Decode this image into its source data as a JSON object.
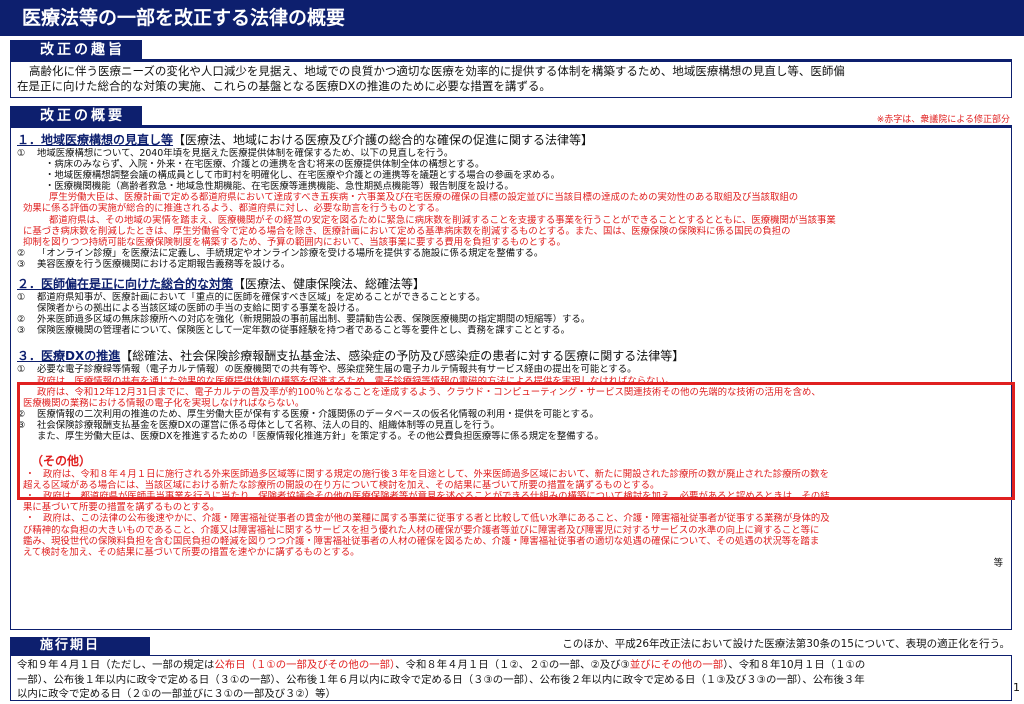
{
  "title": "医療法等の一部を改正する法律の概要",
  "shushi": {
    "label": "改正の趣旨",
    "lines": [
      "高齢化に伴う医療ニーズの変化や人口減少を見据え、地域での良質かつ適切な医療を効率的に提供する体制を構築するため、地域医療構想の見直し等、医師偏",
      "在是正に向けた総合的な対策の実施、これらの基盤となる医療DXの推進のために必要な措置を講ずる。"
    ]
  },
  "gaiyo": {
    "label": "改正の概要",
    "note": "※赤字は、衆議院による修正部分",
    "s1": {
      "num": "１．",
      "heading": "地域医療構想の見直し等",
      "law": "【医療法、地域における医療及び介護の総合的な確保の促進に関する法律等】",
      "i1": {
        "num": "①",
        "text": "地域医療構想について、2040年頃を見据えた医療提供体制を確保するため、以下の見直しを行う。",
        "subs": [
          "・病床のみならず、入院・外来・在宅医療、介護との連携を含む将来の医療提供体制全体の構想とする。",
          "・地域医療構想調整会議の構成員として市町村を明確化し、在宅医療や介護との連携等を議題とする場合の参画を求める。",
          "・医療機関機能（高齢者救急・地域急性期機能、在宅医療等連携機能、急性期拠点機能等）報告制度を設ける。"
        ],
        "red": [
          "厚生労働大臣は、医療計画で定める都道府県において達成すべき五疾病・六事業及び在宅医療の確保の目標の設定並びに当該目標の達成のための実効性のある取組及び当該取組の",
          "効果に係る評価の実施が総合的に推進されるよう、都道府県に対し、必要な助言を行うものとする。",
          "都道府県は、その地域の実情を踏まえ、医療機関がその経営の安定を図るために緊急に病床数を削減することを支援する事業を行うことができることとするとともに、医療機関が当該事業",
          "に基づき病床数を削減したときは、厚生労働省令で定める場合を除き、医療計画において定める基準病床数を削減するものとする。また、国は、医療保険の保険料に係る国民の負担の",
          "抑制を図りつつ持続可能な医療保険制度を構築するため、予算の範囲内において、当該事業に要する費用を負担するものとする。"
        ]
      },
      "i2": {
        "num": "②",
        "text": "「オンライン診療」を医療法に定義し、手続規定やオンライン診療を受ける場所を提供する施設に係る規定を整備する。"
      },
      "i3": {
        "num": "③",
        "text": "美容医療を行う医療機関における定期報告義務等を設ける。"
      }
    },
    "s2": {
      "num": "２．",
      "heading": "医師偏在是正に向けた総合的な対策",
      "law": "【医療法、健康保険法、総確法等】",
      "i1": {
        "num": "①",
        "text": "都道府県知事が、医療計画において「重点的に医師を確保すべき区域」を定めることができることとする。",
        "cont": "保険者からの拠出による当該区域の医師の手当の支給に関する事業を設ける。"
      },
      "i2": {
        "num": "②",
        "text": "外来医師過多区域の無床診療所への対応を強化（新規開設の事前届出制、要請勧告公表、保険医療機関の指定期間の短縮等）する。"
      },
      "i3": {
        "num": "③",
        "text": "保険医療機関の管理者について、保険医として一定年数の従事経験を持つ者であること等を要件とし、責務を課すこととする。"
      }
    },
    "s3": {
      "num": "３．",
      "heading": "医療DXの推進",
      "law": "【総確法、社会保険診療報酬支払基金法、感染症の予防及び感染症の患者に対する医療に関する法律等】",
      "i1": {
        "num": "①",
        "text": "必要な電子診療録等情報（電子カルテ情報）の医療機関での共有等や、感染症発生届の電子カルテ情報共有サービス経由の提出を可能とする。",
        "red": [
          "政府は、医療情報の共有を通じた効果的な医療提供体制の構築を促進するため、電子診療録等情報の電磁的方法による提供を実現しなければならない。",
          "政府は、令和12年12月31日までに、電子カルテの普及率が約100％となることを達成するよう、クラウド・コンピューティング・サービス関連技術その他の先端的な技術の活用を含め、",
          "医療機関の業務における情報の電子化を実現しなければならない。"
        ]
      },
      "i2": {
        "num": "②",
        "text": "医療情報の二次利用の推進のため、厚生労働大臣が保有する医療・介護関係のデータベースの仮名化情報の利用・提供を可能とする。"
      },
      "i3": {
        "num": "③",
        "text": "社会保険診療報酬支払基金を医療DXの運営に係る母体として名称、法人の目的、組織体制等の見直しを行う。",
        "cont": "また、厚生労働大臣は、医療DXを推進するための「医療情報化推進方針」を策定する。その他公費負担医療等に係る規定を整備する。"
      }
    },
    "sonota": {
      "title": "（その他）",
      "items": [
        [
          "・",
          "政府は、令和８年４月１日に施行される外来医師過多区域等に関する規定の施行後３年を目途として、外来医師過多区域において、新たに開設された診療所の数が廃止された診療所の数を",
          "超える区域がある場合には、当該区域における新たな診療所の開設の在り方について検討を加え、その結果に基づいて所要の措置を講ずるものとする。"
        ],
        [
          "・",
          "政府は、都道府県が医師手当事業を行うに当たり、保険者協議会その他の医療保険者等が意見を述べることができる仕組みの構築について検討を加え、必要があると認めるときは、その結",
          "果に基づいて所要の措置を講ずるものとする。"
        ],
        [
          "・",
          "政府は、この法律の公布後速やかに、介護・障害福祉従事者の賃金が他の業種に属する事業に従事する者と比較して低い水準にあること、介護・障害福祉従事者が従事する業務が身体的及",
          "び精神的な負担の大きいものであること、介護又は障害福祉に関するサービスを担う優れた人材の確保が要介護者等並びに障害者及び障害児に対するサービスの水準の向上に資すること等に",
          "鑑み、現役世代の保険料負担を含む国民負担の軽減を図りつつ介護・障害福祉従事者の人材の確保を図るため、介護・障害福祉従事者の適切な処遇の確保について、その処遇の状況等を踏ま",
          "えて検討を加え、その結果に基づいて所要の措置を速やかに講ずるものとする。"
        ]
      ],
      "tail": "等"
    }
  },
  "sekou": {
    "label": "施行期日",
    "note": "このほか、平成26年改正法において設けた医療法第30条の15について、表現の適正化を行う。",
    "l1a": "令和９年４月１日（ただし、一部の規定は",
    "l1r1": "公布日（１①の一部及びその他の一部）",
    "l1b": "、令和８年４月１日（１②、２①の一部、②及び③",
    "l1r2": "並びにその他の一部",
    "l1c": "）、令和８年10月１日（１①の",
    "l2": "一部）、公布後１年以内に政令で定める日（３①の一部）、公布後１年６月以内に政令で定める日（３③の一部）、公布後２年以内に政令で定める日（１③及び３③の一部）、公布後３年",
    "l3": "以内に政令で定める日（２①の一部並びに３①の一部及び３②）等）"
  },
  "page_number": "1",
  "colors": {
    "navy": "#0d1f6e",
    "red": "#e02020"
  }
}
